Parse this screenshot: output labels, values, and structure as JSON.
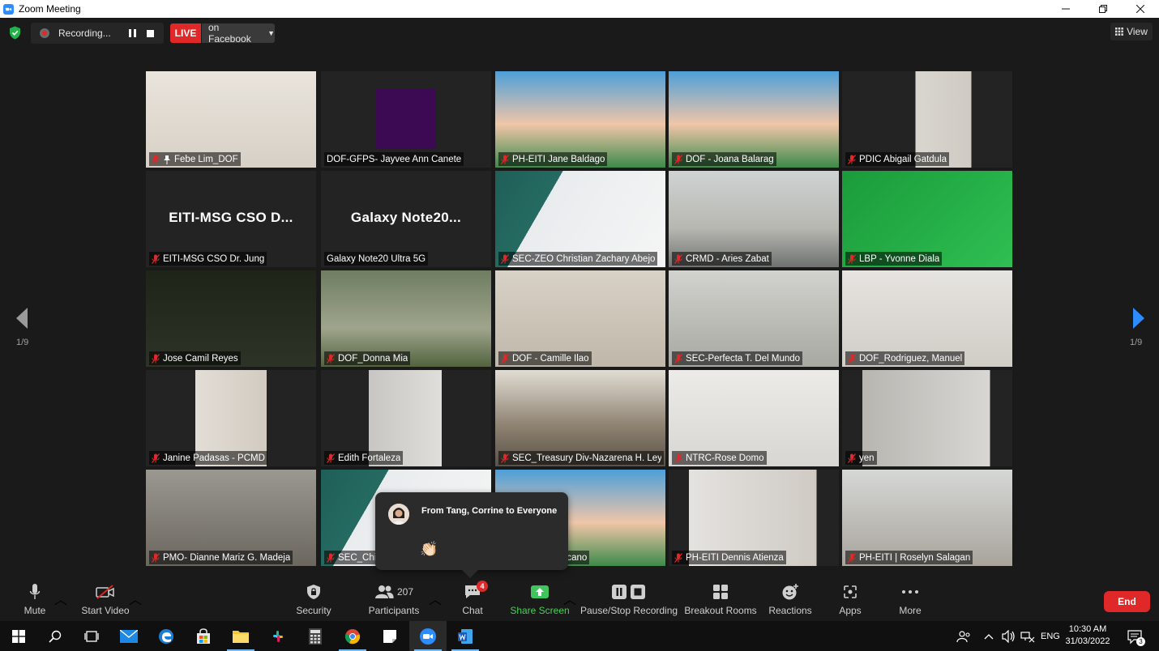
{
  "window": {
    "title": "Zoom Meeting"
  },
  "topbar": {
    "recording_label": "Recording...",
    "live_label": "LIVE",
    "stream_target": "on Facebook",
    "view_label": "View"
  },
  "grid": {
    "page_left": "1/9",
    "page_right": "1/9",
    "tiles": [
      {
        "name": "Febe Lim_DOF",
        "big": "",
        "muted": true,
        "pinned": true
      },
      {
        "name": "DOF-GFPS- Jayvee Ann Canete",
        "big": "",
        "muted": false,
        "pinned": false
      },
      {
        "name": "PH-EITI Jane Baldago",
        "big": "",
        "muted": true,
        "pinned": false
      },
      {
        "name": "DOF - Joana Balarag",
        "big": "",
        "muted": true,
        "pinned": false
      },
      {
        "name": "PDIC Abigail Gatdula",
        "big": "",
        "muted": true,
        "pinned": false
      },
      {
        "name": "EITI-MSG CSO Dr. Jung",
        "big": "EITI-MSG CSO D...",
        "muted": true,
        "pinned": false
      },
      {
        "name": "Galaxy Note20 Ultra 5G",
        "big": "Galaxy Note20...",
        "muted": false,
        "pinned": false
      },
      {
        "name": "SEC-ZEO Christian Zachary Abejo",
        "big": "",
        "muted": true,
        "pinned": false
      },
      {
        "name": "CRMD - Aries Zabat",
        "big": "",
        "muted": true,
        "pinned": false
      },
      {
        "name": "LBP - Yvonne Diala",
        "big": "",
        "muted": true,
        "pinned": false
      },
      {
        "name": "Jose Camil Reyes",
        "big": "",
        "muted": true,
        "pinned": false
      },
      {
        "name": "DOF_Donna Mia",
        "big": "",
        "muted": true,
        "pinned": false
      },
      {
        "name": "DOF - Camille Ilao",
        "big": "",
        "muted": true,
        "pinned": false
      },
      {
        "name": "SEC-Perfecta T. Del Mundo",
        "big": "",
        "muted": true,
        "pinned": false
      },
      {
        "name": "DOF_Rodriguez, Manuel",
        "big": "",
        "muted": true,
        "pinned": false
      },
      {
        "name": "Janine Padasas - PCMD",
        "big": "",
        "muted": true,
        "pinned": false
      },
      {
        "name": "Edith  Fortaleza",
        "big": "",
        "muted": true,
        "pinned": false
      },
      {
        "name": "SEC_Treasury Div-Nazarena H. Ley...",
        "big": "",
        "muted": true,
        "pinned": false
      },
      {
        "name": "NTRC-Rose Domo",
        "big": "",
        "muted": true,
        "pinned": false
      },
      {
        "name": "yen",
        "big": "",
        "muted": true,
        "pinned": false
      },
      {
        "name": "PMO- Dianne Mariz G. Madeja",
        "big": "",
        "muted": true,
        "pinned": false
      },
      {
        "name": "SEC_Chic",
        "big": "",
        "muted": true,
        "pinned": false
      },
      {
        "name": "resencia Lyn Escano",
        "big": "",
        "muted": false,
        "pinned": false
      },
      {
        "name": "PH-EITI Dennis Atienza",
        "big": "",
        "muted": true,
        "pinned": false
      },
      {
        "name": "PH-EITI | Roselyn Salagan",
        "big": "",
        "muted": true,
        "pinned": false
      }
    ]
  },
  "chat_popup": {
    "from": "From Tang, Corrine to Everyone",
    "message": "👏🏻"
  },
  "toolbar": {
    "mute": "Mute",
    "start_video": "Start Video",
    "security": "Security",
    "participants": "Participants",
    "participants_count": "207",
    "chat": "Chat",
    "chat_badge": "4",
    "share_screen": "Share Screen",
    "pause_stop_recording": "Pause/Stop Recording",
    "breakout_rooms": "Breakout Rooms",
    "reactions": "Reactions",
    "apps": "Apps",
    "more": "More",
    "end": "End"
  },
  "taskbar": {
    "language": "ENG",
    "time": "10:30 AM",
    "date": "31/03/2022",
    "notification_count": "3"
  },
  "colors": {
    "zoom_blue": "#2d8cff",
    "live_red": "#e02828",
    "share_green": "#4ad05a",
    "active_speaker": "#c7e35a"
  }
}
